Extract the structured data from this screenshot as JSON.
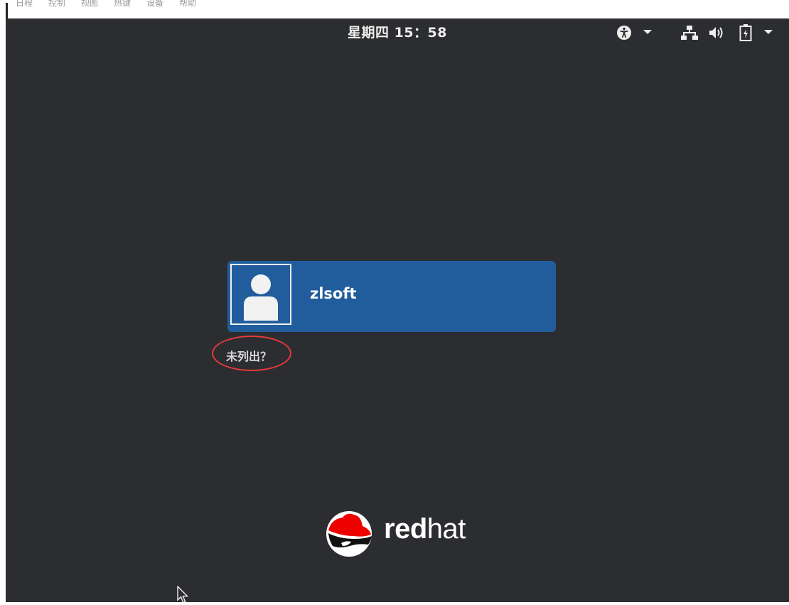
{
  "host_menu": {
    "items": [
      "日程",
      "控制",
      "视图",
      "热键",
      "设备",
      "帮助"
    ]
  },
  "top_panel": {
    "clock": "星期四 15：58",
    "icons": [
      "accessibility-icon",
      "chevron-down-icon",
      "network-icon",
      "volume-icon",
      "battery-icon",
      "chevron-down-icon"
    ]
  },
  "login": {
    "username": "zlsoft",
    "not_listed": "未列出？"
  },
  "logo": {
    "brand_bold": "red",
    "brand_light": "hat"
  },
  "colors": {
    "background": "#2c2d30",
    "card": "#215d9c",
    "highlight": "#e23a3a",
    "logo_red": "#ee0000"
  }
}
